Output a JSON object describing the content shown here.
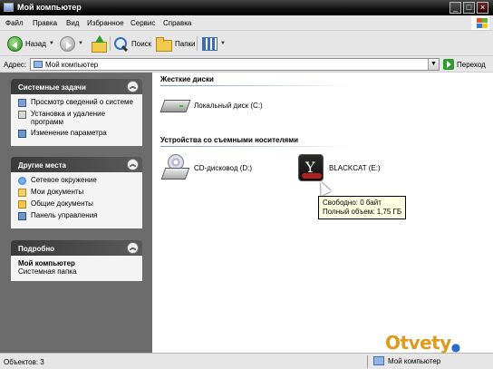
{
  "window": {
    "title": "Мой компьютер"
  },
  "menu": [
    "Файл",
    "Правка",
    "Вид",
    "Избранное",
    "Сервис",
    "Справка"
  ],
  "toolbar": {
    "back_label": "Назад",
    "search_label": "Поиск",
    "folders_label": "Папки"
  },
  "address": {
    "label": "Адрес:",
    "value": "Мой компьютер",
    "go_label": "Переход"
  },
  "sidebar": {
    "system_tasks": {
      "title": "Системные задачи",
      "items": [
        {
          "label": "Просмотр сведений о системе",
          "icon": "system-info-icon"
        },
        {
          "label": "Установка и удаление программ",
          "icon": "add-remove-icon"
        },
        {
          "label": "Изменение параметра",
          "icon": "settings-icon"
        }
      ]
    },
    "other_places": {
      "title": "Другие места",
      "items": [
        {
          "label": "Сетевое окружение",
          "icon": "network-icon"
        },
        {
          "label": "Мои документы",
          "icon": "my-documents-icon"
        },
        {
          "label": "Общие документы",
          "icon": "shared-documents-icon"
        },
        {
          "label": "Панель управления",
          "icon": "control-panel-icon"
        }
      ]
    },
    "details": {
      "title": "Подробно",
      "name": "Мой компьютер",
      "type": "Системная папка"
    }
  },
  "content": {
    "hard_drives": {
      "title": "Жесткие диски",
      "drives": [
        {
          "label": "Локальный диск (C:)",
          "icon": "hard-disk-icon"
        }
      ]
    },
    "removable": {
      "title": "Устройства со съемными носителями",
      "drives": [
        {
          "label": "CD-дисковод (D:)",
          "icon": "cd-drive-icon"
        },
        {
          "label": "BLACKCAT (E:)",
          "icon": "usb-drive-icon"
        }
      ]
    },
    "tooltip": {
      "free": "Свободно: 0 байт",
      "total": "Полный объем: 1,75 ГБ"
    }
  },
  "status": {
    "objects": "Объектов: 3",
    "location": "Мой компьютер"
  },
  "watermark": {
    "text": "Otvety"
  },
  "colors": {
    "sidebar_bg": "#6c6c6c",
    "panel_head": "#3a3a3a",
    "tooltip_bg": "#ffffe1",
    "watermark": "#e09a1b"
  }
}
